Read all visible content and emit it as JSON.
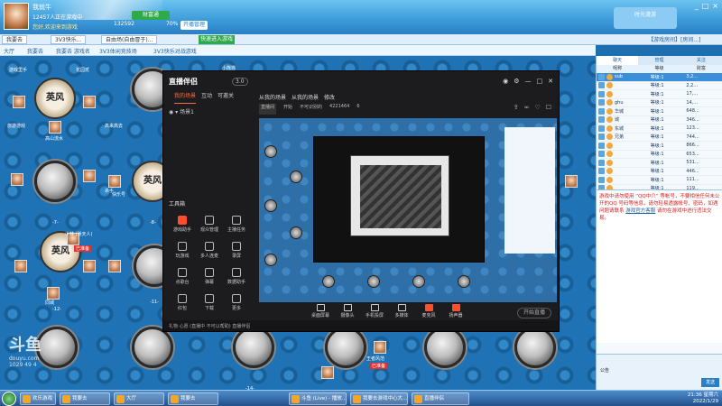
{
  "topbar": {
    "name": "我就牛",
    "status": "12457人正在游戏中",
    "net_text": "您好,欢迎来到游戏",
    "coin": "132592",
    "pct": "70%",
    "badge_text": "开播管理",
    "green_btn": "财富通",
    "brand_text": "时光漫游",
    "controls": [
      "_",
      "□",
      "×"
    ]
  },
  "tabs": [
    {
      "label": "我要去"
    },
    {
      "label": "3V3快乐..."
    },
    {
      "label": "自由场(自由冒于)..."
    }
  ],
  "toolbar2": {
    "extra": "快速进入游戏",
    "right": "【游戏房间】[房间...]"
  },
  "breadcrumbs": [
    "大厅",
    "我要去",
    "我要去 游戏名",
    "3V3体闲竞技场",
    "3V3快乐对战游戏"
  ],
  "room": {
    "emblem_text": "英风",
    "seat_labels": [
      "-7-",
      "-8-",
      "-11-",
      "-12-",
      "-14-"
    ],
    "players": [
      "游戏里手",
      "花园贰",
      "高来高去",
      "旅游游戏",
      "高山流水",
      "冰岛朋友",
      "杀手",
      "快乐号",
      "少林 (骄天人)",
      "清泉石",
      "同城",
      "自由",
      "加油",
      "好人",
      "开心",
      "王者风范",
      "水泽",
      "明日花",
      "佛祖",
      "小熊猫"
    ],
    "red_tags": [
      "已准备",
      "已准备"
    ]
  },
  "app": {
    "logo": "直播伴侣",
    "version": "3.0",
    "nav": [
      "我的场景",
      "互动",
      "可邀关"
    ],
    "scene_label": "场景1",
    "toolbox_label": "工具箱",
    "tools": [
      {
        "label": "游戏助手"
      },
      {
        "label": "观众管理"
      },
      {
        "label": "主播任务"
      },
      {
        "label": "玩游戏"
      },
      {
        "label": "多人连麦"
      },
      {
        "label": "录屏"
      },
      {
        "label": "点歌台"
      },
      {
        "label": "弹幕"
      },
      {
        "label": "数据助手"
      },
      {
        "label": "红包"
      },
      {
        "label": "下载"
      },
      {
        "label": "更多"
      }
    ],
    "stage_head": [
      "从我的场景",
      "从我的场景",
      "修改"
    ],
    "stage_info": [
      "直播间",
      "开始",
      "不可识别的",
      "4221464",
      "6"
    ],
    "bottom_buttons": [
      "桌面屏幕",
      "摄像头",
      "手机投屏",
      "多媒体",
      "麦克风",
      "扬声器"
    ],
    "golive": "开始直播",
    "status": "礼物·心愿  (直播中 不可以帮助) 直播伴侣"
  },
  "userlist": {
    "tabs": [
      "聊天",
      "管理",
      "关注"
    ],
    "head": [
      "呢称",
      "等级",
      "财富"
    ],
    "rows": [
      {
        "name": "sub",
        "level": "等级:1",
        "score": "3,2..."
      },
      {
        "name": "",
        "level": "等级:1",
        "score": "2,2..."
      },
      {
        "name": "",
        "level": "等级:1",
        "score": "17,..."
      },
      {
        "name": "ghu",
        "level": "等级:1",
        "score": "14,..."
      },
      {
        "name": "华城",
        "level": "等级:1",
        "score": "648..."
      },
      {
        "name": "城",
        "level": "等级:1",
        "score": "346..."
      },
      {
        "name": "东城",
        "level": "等级:1",
        "score": "123..."
      },
      {
        "name": "兄弟",
        "level": "等级:1",
        "score": "744..."
      },
      {
        "name": "",
        "level": "等级:1",
        "score": "866..."
      },
      {
        "name": "",
        "level": "等级:1",
        "score": "653..."
      },
      {
        "name": "",
        "level": "等级:1",
        "score": "531..."
      },
      {
        "name": "",
        "level": "等级:1",
        "score": "446..."
      },
      {
        "name": "",
        "level": "等级:1",
        "score": "111..."
      },
      {
        "name": "",
        "level": "等级:1",
        "score": "119..."
      }
    ],
    "chat_line1": "游戏中请勿使用 “QQ中介” 等帐号，不要相信任何未公开的QQ",
    "chat_line2": "号码等信息，请勿轻易透露帐号、密码，如遇问题请联系",
    "chat_link": "游戏官方客服",
    "chat_line3": "请勿在游戏中进行违法交易。",
    "input_label": "公告",
    "send": "发送"
  },
  "watermark": {
    "brand": "斗鱼",
    "url": "douyu.com",
    "room": "1029 49 4"
  },
  "taskbar": {
    "items": [
      {
        "label": "欢乐游戏"
      },
      {
        "label": "我要去"
      },
      {
        "label": "大厅"
      },
      {
        "label": "我要去"
      },
      {
        "label": "斗鱼 (Live) - 播放..."
      },
      {
        "label": "我要去游戏中心大..."
      },
      {
        "label": "直播伴侣"
      }
    ],
    "time": "21:36 星期六",
    "date": "2022/1/29"
  }
}
